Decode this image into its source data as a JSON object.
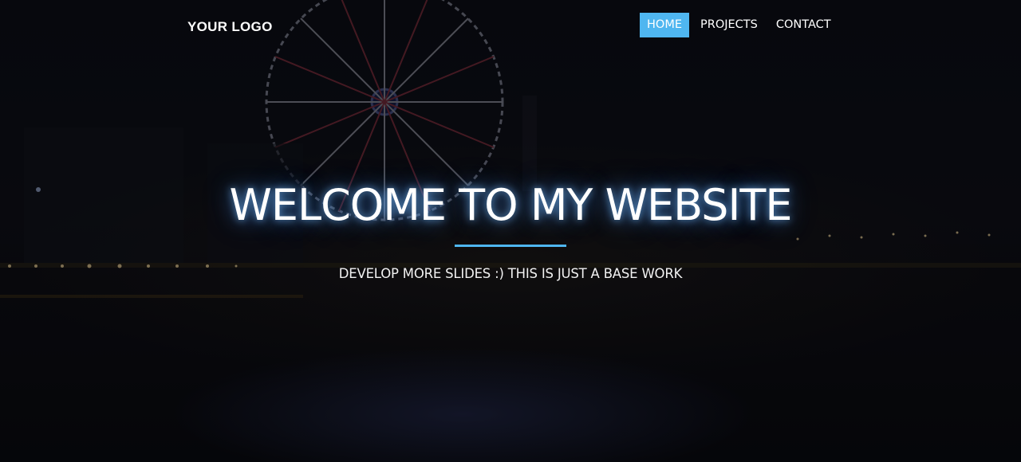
{
  "header": {
    "logo_text": "YOUR LOGO",
    "nav": [
      {
        "label": "HOME",
        "active": true
      },
      {
        "label": "PROJECTS",
        "active": false
      },
      {
        "label": "CONTACT",
        "active": false
      }
    ]
  },
  "hero": {
    "title": "WELCOME TO MY WEBSITE",
    "subtitle": "DEVELOP MORE SLIDES :) THIS IS JUST A BASE WORK"
  },
  "colors": {
    "accent": "#4fb6f0",
    "background": "#07080c",
    "text": "#ffffff"
  }
}
